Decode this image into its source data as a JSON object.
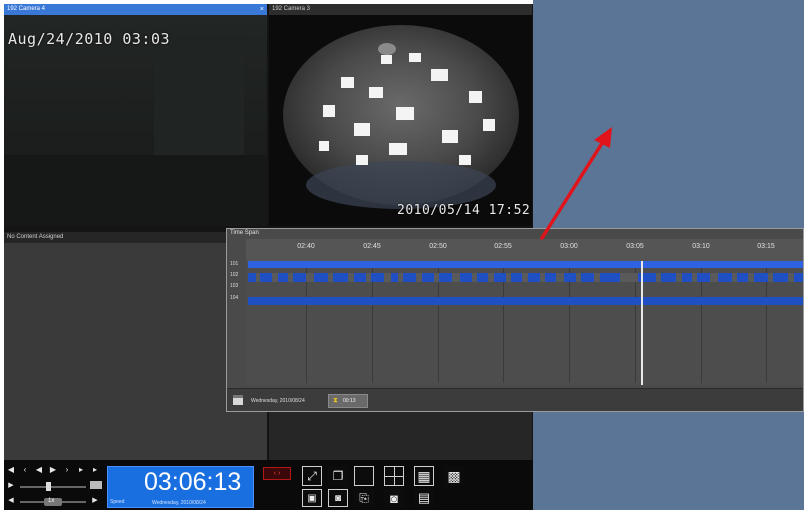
{
  "panes": {
    "camera1_title": "192 Camera 4",
    "camera1_timestamp": "Aug/24/2010 03:03",
    "camera2_title": "192 Camera 3",
    "camera2_timestamp": "2010/05/14 17:52",
    "camera3_title": "No Content Assigned"
  },
  "timespan": {
    "title": "Time Span",
    "ticks": [
      "02:40",
      "02:45",
      "02:50",
      "02:55",
      "03:00",
      "03:05",
      "03:10",
      "03:15"
    ],
    "track_labels": [
      "101",
      "102",
      "103",
      "104"
    ],
    "date_label": "Wednesday, 2010/08/24",
    "rate_label": "00:13"
  },
  "playback": {
    "clock": "03:06:13",
    "speed_label": "Speed",
    "date": "Wednesday, 2010/08/24",
    "speed_value": "1x"
  },
  "colors": {
    "accent_blue": "#3a78d8",
    "track_blue": "#1f4fc2",
    "desktop": "#5a7596",
    "arrow_red": "#e0141a",
    "clock_bg": "#1a6fe0"
  }
}
